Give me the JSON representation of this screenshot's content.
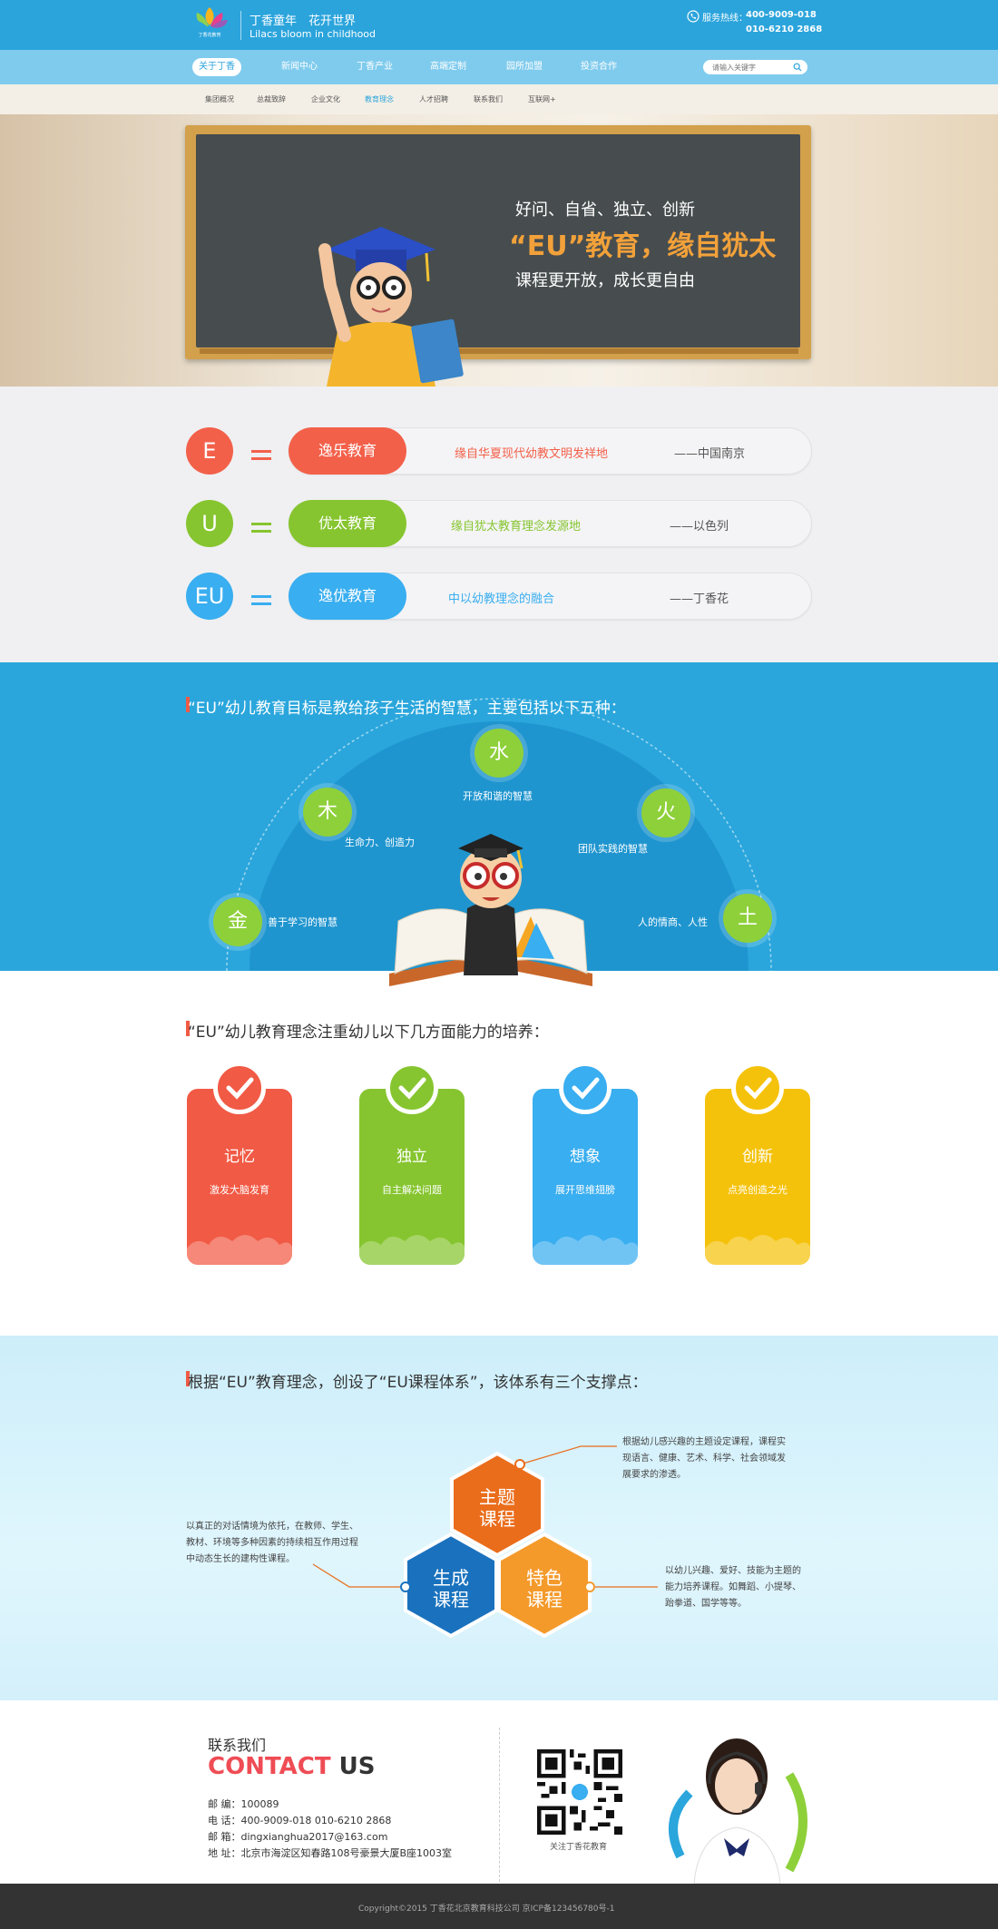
{
  "header": {
    "logo_text": "丁香花教育",
    "slogan_cn": "丁香童年　花开世界",
    "slogan_en": "Lilacs bloom in childhood",
    "hotline_label": "服务热线：",
    "hotline_1": "400-9009-018",
    "hotline_2": "010-6210 2868"
  },
  "nav": {
    "items": [
      "关于丁香",
      "新闻中心",
      "丁香产业",
      "高端定制",
      "园所加盟",
      "投资合作"
    ],
    "active": "关于丁香",
    "search_placeholder": "请输入关键字"
  },
  "subnav": {
    "items": [
      "集团概况",
      "总裁致辞",
      "企业文化",
      "教育理念",
      "人才招聘",
      "联系我们",
      "互联网+"
    ],
    "active": "教育理念"
  },
  "banner": {
    "line1": "好问、自省、独立、创新",
    "line2": "“EU”教育，缘自犹太",
    "line3": "课程更开放，成长更自由"
  },
  "eu": [
    {
      "letter": "E",
      "name": "逸乐教育",
      "desc": "缘自华夏现代幼教文明发祥地",
      "source": "——中国南京",
      "color": "#f3604a"
    },
    {
      "letter": "U",
      "name": "优太教育",
      "desc": "缘自犹太教育理念发源地",
      "source": "——以色列",
      "color": "#86c52f"
    },
    {
      "letter": "EU",
      "name": "逸优教育",
      "desc": "中以幼教理念的融合",
      "source": "——丁香花",
      "color": "#39aef0"
    }
  ],
  "five": {
    "title": "“EU”幼儿教育目标是教给孩子生活的智慧，主要包括以下五种：",
    "elements": [
      {
        "char": "金",
        "label": "善于学习的智慧"
      },
      {
        "char": "木",
        "label": "生命力、创造力"
      },
      {
        "char": "水",
        "label": "开放和谐的智慧"
      },
      {
        "char": "火",
        "label": "团队实践的智慧"
      },
      {
        "char": "土",
        "label": "人的情商、人性"
      }
    ]
  },
  "abilities": {
    "title": "“EU”幼儿教育理念注重幼儿以下几方面能力的培养：",
    "cards": [
      {
        "title": "记忆",
        "sub": "激发大脑发育",
        "color": "#f15a45"
      },
      {
        "title": "独立",
        "sub": "自主解决问题",
        "color": "#86c52f"
      },
      {
        "title": "想象",
        "sub": "展开思维翅膀",
        "color": "#39aef0"
      },
      {
        "title": "创新",
        "sub": "点亮创造之光",
        "color": "#f5c20b"
      }
    ]
  },
  "system": {
    "title": "根据“EU”教育理念，创设了“EU课程体系”，该体系有三个支撑点：",
    "hexes": [
      {
        "name": "主题\n课程",
        "line1": "主题",
        "line2": "课程",
        "color": "#ea6d1c"
      },
      {
        "name": "生成课程",
        "line1": "生成",
        "line2": "课程",
        "color": "#1a72be"
      },
      {
        "name": "特色课程",
        "line1": "特色",
        "line2": "课程",
        "color": "#f49a2b"
      }
    ],
    "desc_theme": [
      "根据幼儿感兴趣的主题设定课程，课程实",
      "现语言、健康、艺术、科学、社会领域发",
      "展要求的渗透。"
    ],
    "desc_gen": [
      "以真正的对话情境为依托，在教师、学生、",
      "教材、环境等多种因素的持续相互作用过程",
      "中动态生长的建构性课程。"
    ],
    "desc_feat": [
      "以幼儿兴趣、爱好、技能为主题的",
      "能力培养课程。如舞蹈、小提琴、",
      "跆拳道、国学等等。"
    ]
  },
  "contact": {
    "heading_cn": "联系我们",
    "heading_en_1": "CONTACT",
    "heading_en_2": " US",
    "lines": [
      "邮  编：100089",
      "电  话：400-9009-018    010-6210 2868",
      "邮  箱：dingxianghua2017@163.com",
      "地  址：北京市海淀区知春路108号豪景大厦B座1003室"
    ],
    "qr_label": "关注丁香花教育"
  },
  "footer": {
    "copyright": "Copyright©2015    丁香花北京教育科技公司    京ICP备123456780号-1"
  }
}
